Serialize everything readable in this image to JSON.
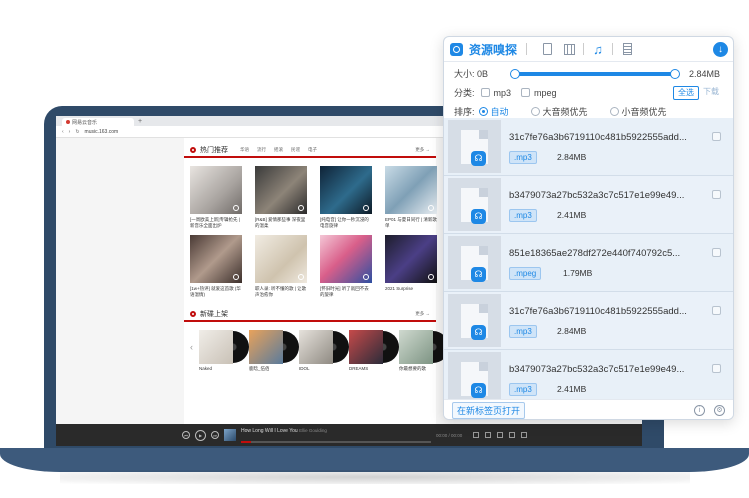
{
  "browser": {
    "tab_title": "网易云音乐",
    "new_tab": "+",
    "url": "music.163.com"
  },
  "site": {
    "hot": {
      "title": "热门推荐",
      "tags": [
        "华语",
        "流行",
        "摇滚",
        "民谣",
        "电子"
      ],
      "more": "更多 →",
      "cards": [
        {
          "caption": "[一周欧美上新]专辑抢先 | 新音乐全面出炉"
        },
        {
          "caption": "[R&B] 爱情那些事 深夜里的温柔"
        },
        {
          "caption": "[纯电音] 让你一秒沉浸的电音旋律"
        },
        {
          "caption": "EP01 与夏日同行 | 清新歌单"
        },
        {
          "caption": "[1w+热评] 就爱这首歌 (华语温情)"
        },
        {
          "caption": "职人录: 听不懂的歌 | 让歌声治愈你"
        },
        {
          "caption": "[怀旧时光] 听了就回不去的旋律"
        },
        {
          "caption": "2021 Surprise"
        }
      ]
    },
    "new_albums": {
      "title": "新碟上架",
      "more": "更多 →",
      "albums": [
        {
          "caption": "Naked"
        },
        {
          "caption": "鹿晗_伍佰"
        },
        {
          "caption": "IDOL"
        },
        {
          "caption": "DREAMS"
        },
        {
          "caption": "你最想要的歌"
        }
      ]
    },
    "player": {
      "song": "How Long Will I Love You",
      "artist": "Ellie Goulding",
      "time": "00:00 / 00:00",
      "progress": 0.05
    }
  },
  "popup": {
    "title": "资源嗅探",
    "size_label": "大小: 0B",
    "size_max": "2.84MB",
    "type_label": "分类:",
    "types": [
      "mp3",
      "mpeg"
    ],
    "select_all": "全选",
    "download": "下载",
    "sort_label": "排序:",
    "sort_options": [
      "自动",
      "大音频优先",
      "小音频优先"
    ],
    "items": [
      {
        "name": "31c7fe76a3b6719110c481b5922555add...",
        "ext": ".mp3",
        "size": "2.84MB"
      },
      {
        "name": "b3479073a27bc532a3c7c517e1e99e49...",
        "ext": ".mp3",
        "size": "2.41MB"
      },
      {
        "name": "851e18365ae278df272e440f740792c5...",
        "ext": ".mpeg",
        "size": "1.79MB"
      },
      {
        "name": "31c7fe76a3b6719110c481b5922555add...",
        "ext": ".mp3",
        "size": "2.84MB"
      },
      {
        "name": "b3479073a27bc532a3c7c517e1e99e49...",
        "ext": ".mp3",
        "size": "2.41MB"
      }
    ],
    "open_new_tab": "在新标签页打开",
    "accent": "#1e88e5"
  }
}
